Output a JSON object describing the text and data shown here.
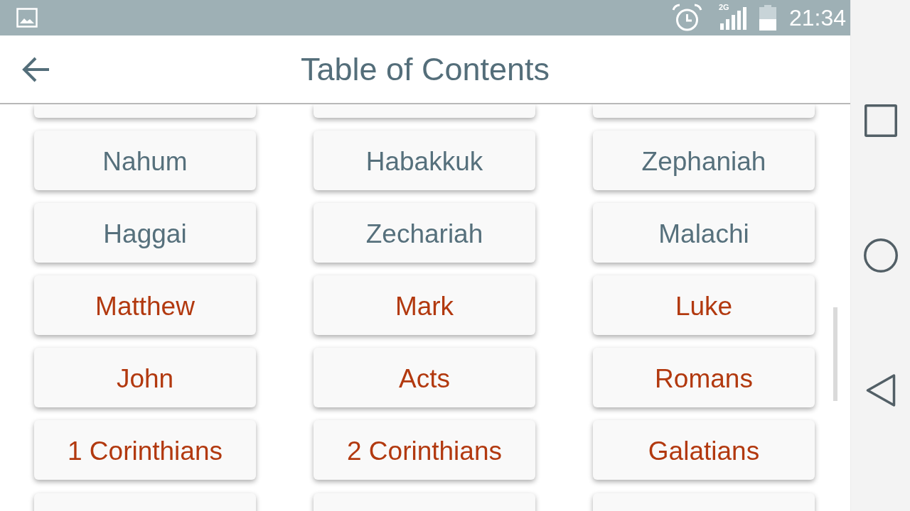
{
  "status_bar": {
    "network": "2G",
    "time": "21:34"
  },
  "app_bar": {
    "title": "Table of Contents"
  },
  "books": [
    {
      "label": "Nahum",
      "color": "#56707c"
    },
    {
      "label": "Habakkuk",
      "color": "#56707c"
    },
    {
      "label": "Zephaniah",
      "color": "#56707c"
    },
    {
      "label": "Haggai",
      "color": "#56707c"
    },
    {
      "label": "Zechariah",
      "color": "#56707c"
    },
    {
      "label": "Malachi",
      "color": "#56707c"
    },
    {
      "label": "Matthew",
      "color": "#b2390f"
    },
    {
      "label": "Mark",
      "color": "#b2390f"
    },
    {
      "label": "Luke",
      "color": "#b2390f"
    },
    {
      "label": "John",
      "color": "#b2390f"
    },
    {
      "label": "Acts",
      "color": "#b2390f"
    },
    {
      "label": "Romans",
      "color": "#b2390f"
    },
    {
      "label": "1 Corinthians",
      "color": "#b2390f"
    },
    {
      "label": "2 Corinthians",
      "color": "#b2390f"
    },
    {
      "label": "Galatians",
      "color": "#b2390f"
    }
  ]
}
